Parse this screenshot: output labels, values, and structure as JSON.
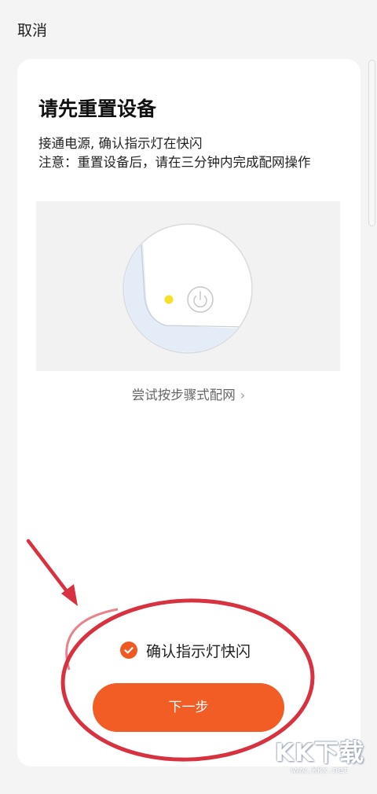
{
  "header": {
    "cancel_label": "取消"
  },
  "card": {
    "title": "请先重置设备",
    "line1": "接通电源, 确认指示灯在快闪",
    "line2": "注意：重置设备后，请在三分钟内完成配网操作",
    "try_link": "尝试按步骤式配网",
    "try_chevron": "›"
  },
  "confirm": {
    "label": "确认指示灯快闪",
    "checked": true
  },
  "next_button_label": "下一步",
  "watermark": {
    "brand": "KK下载",
    "url": "www.kkx.net"
  },
  "colors": {
    "accent": "#f25d26",
    "annotation": "#d8313f",
    "indicator": "#f5e02a"
  }
}
